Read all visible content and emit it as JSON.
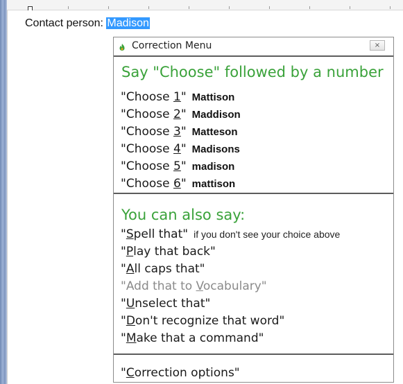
{
  "document": {
    "contact_label": "Contact person:",
    "contact_value": "Madison"
  },
  "menu": {
    "title": "Correction Menu",
    "close_label": "×",
    "heading_choose": "Say \"Choose\" followed by a number",
    "choices": [
      {
        "pre": "\"Choose ",
        "num": "1",
        "post": "\"",
        "word": "Mattison"
      },
      {
        "pre": "\"Choose ",
        "num": "2",
        "post": "\"",
        "word": "Maddison"
      },
      {
        "pre": "\"Choose ",
        "num": "3",
        "post": "\"",
        "word": "Matteson"
      },
      {
        "pre": "\"Choose ",
        "num": "4",
        "post": "\"",
        "word": "Madisons"
      },
      {
        "pre": "\"Choose ",
        "num": "5",
        "post": "\"",
        "word": "madison"
      },
      {
        "pre": "\"Choose ",
        "num": "6",
        "post": "\"",
        "word": "mattison"
      }
    ],
    "heading_also": "You can also say:",
    "commands": [
      {
        "pre": "\"",
        "key": "S",
        "rest": "pell that\"",
        "hint": "if you don't see your choice above",
        "disabled": false
      },
      {
        "pre": "\"",
        "key": "P",
        "rest": "lay that back\"",
        "hint": "",
        "disabled": false
      },
      {
        "pre": "\"",
        "key": "A",
        "rest": "ll caps that\"",
        "hint": "",
        "disabled": false
      },
      {
        "pre": "\"Add that to ",
        "key": "V",
        "rest": "ocabulary\"",
        "hint": "",
        "disabled": true
      },
      {
        "pre": "\"",
        "key": "U",
        "rest": "nselect that\"",
        "hint": "",
        "disabled": false
      },
      {
        "pre": "\"",
        "key": "D",
        "rest": "on't recognize that word\"",
        "hint": "",
        "disabled": false
      },
      {
        "pre": "\"",
        "key": "M",
        "rest": "ake that a command\"",
        "hint": "",
        "disabled": false
      }
    ],
    "options": {
      "pre": "\"",
      "key": "C",
      "rest": "orrection options\""
    }
  },
  "colors": {
    "accent_green": "#3aa23a",
    "selection": "#3399ff"
  },
  "icons": {
    "title_icon": "flame-icon",
    "close": "close-icon"
  }
}
